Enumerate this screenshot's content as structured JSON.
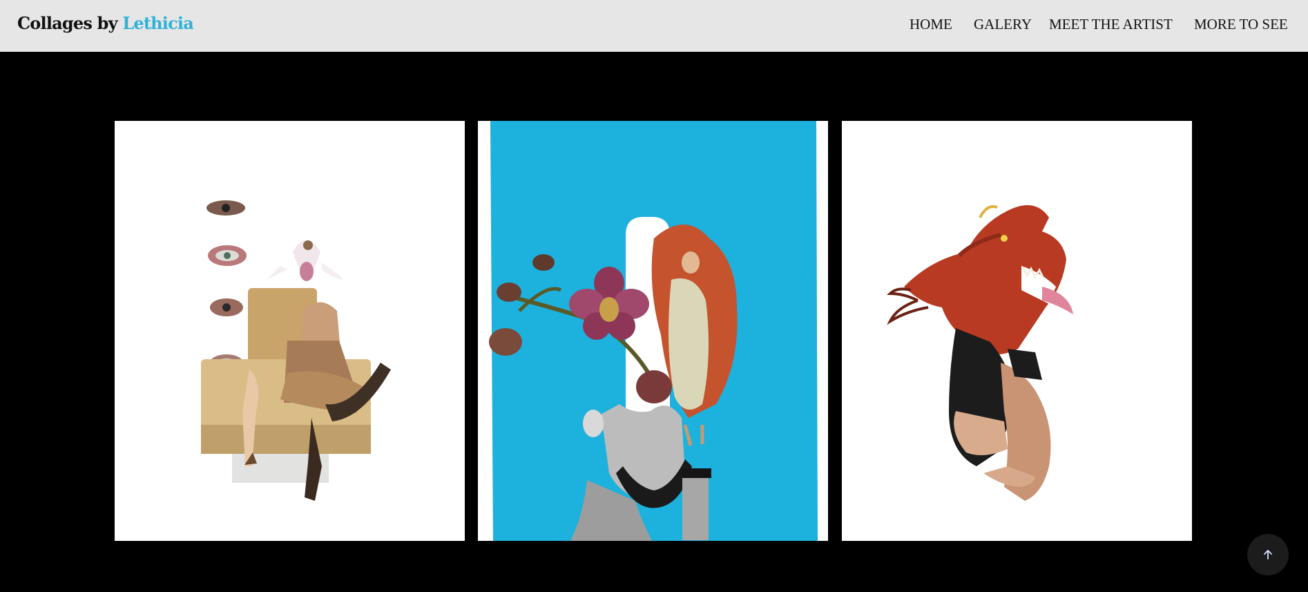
{
  "header": {
    "brand_prefix": "Collages by",
    "brand_accent": "Lethicia",
    "accent_color": "#2fb2d8"
  },
  "nav": {
    "items": [
      {
        "label": "HOME"
      },
      {
        "label": "GALERY"
      },
      {
        "label": "MEET THE ARTIST"
      },
      {
        "label": "MORE TO SEE"
      }
    ]
  },
  "gallery": {
    "items": [
      {
        "icon": "collage-woman-armchair-eyes-image"
      },
      {
        "icon": "collage-orchid-blue-background-image"
      },
      {
        "icon": "collage-dragon-head-figure-image"
      }
    ]
  },
  "scroll_top": {
    "icon": "arrow-up-icon"
  }
}
